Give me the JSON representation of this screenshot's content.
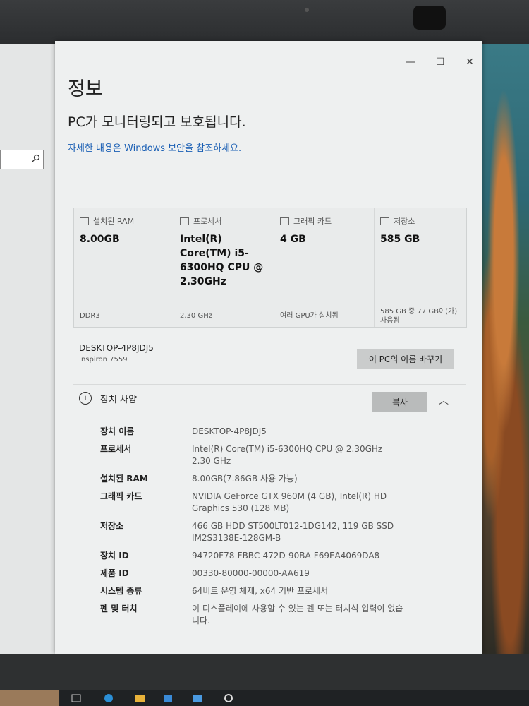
{
  "window": {
    "title": "정보",
    "controls": [
      "—",
      "☐",
      "✕"
    ]
  },
  "security": {
    "status": "PC가 모니터링되고 보호됩니다.",
    "link": "자세한 내용은 Windows 보안을 참조하세요."
  },
  "summary": {
    "cards": [
      {
        "head": "설치된 RAM",
        "value": "8.00GB",
        "foot": "DDR3"
      },
      {
        "head": "프로세서",
        "value": "Intel(R) Core(TM) i5-6300HQ CPU @ 2.30GHz",
        "foot": "2.30 GHz"
      },
      {
        "head": "그래픽 카드",
        "value": "4 GB",
        "foot": "여러 GPU가 설치됨"
      },
      {
        "head": "저장소",
        "value": "585 GB",
        "foot": "585 GB 중 77 GB이(가) 사용됨"
      }
    ]
  },
  "pc": {
    "name": "DESKTOP-4P8JDJ5",
    "model": "Inspiron 7559",
    "rename_label": "이 PC의 이름 바꾸기"
  },
  "specs": {
    "title": "장치 사양",
    "copy_label": "복사",
    "rows": [
      {
        "label": "장치 이름",
        "value": "DESKTOP-4P8JDJ5"
      },
      {
        "label": "프로세서",
        "value": "Intel(R) Core(TM) i5-6300HQ CPU @ 2.30GHz 2.30 GHz"
      },
      {
        "label": "설치된 RAM",
        "value": "8.00GB(7.86GB 사용 가능)"
      },
      {
        "label": "그래픽 카드",
        "value": "NVIDIA GeForce GTX 960M (4 GB), Intel(R) HD Graphics 530 (128 MB)"
      },
      {
        "label": "저장소",
        "value": "466 GB HDD ST500LT012-1DG142, 119 GB SSD IM2S3138E-128GM-B"
      },
      {
        "label": "장치 ID",
        "value": "94720F78-FBBC-472D-90BA-F69EA4069DA8"
      },
      {
        "label": "제품 ID",
        "value": "00330-80000-00000-AA619"
      },
      {
        "label": "시스템 종류",
        "value": "64비트 운영 체제, x64 기반 프로세서"
      },
      {
        "label": "펜 및 터치",
        "value": "이 디스플레이에 사용할 수 있는 펜 또는 터치식 입력이 없습니다."
      }
    ]
  },
  "icons": {
    "search": "search-icon",
    "info": "info-icon",
    "ram": "memory-icon",
    "cpu": "processor-icon",
    "gpu": "graphics-card-icon",
    "storage": "storage-icon"
  },
  "colors": {
    "link": "#1a5fb4",
    "window_bg": "#eef0f0"
  }
}
